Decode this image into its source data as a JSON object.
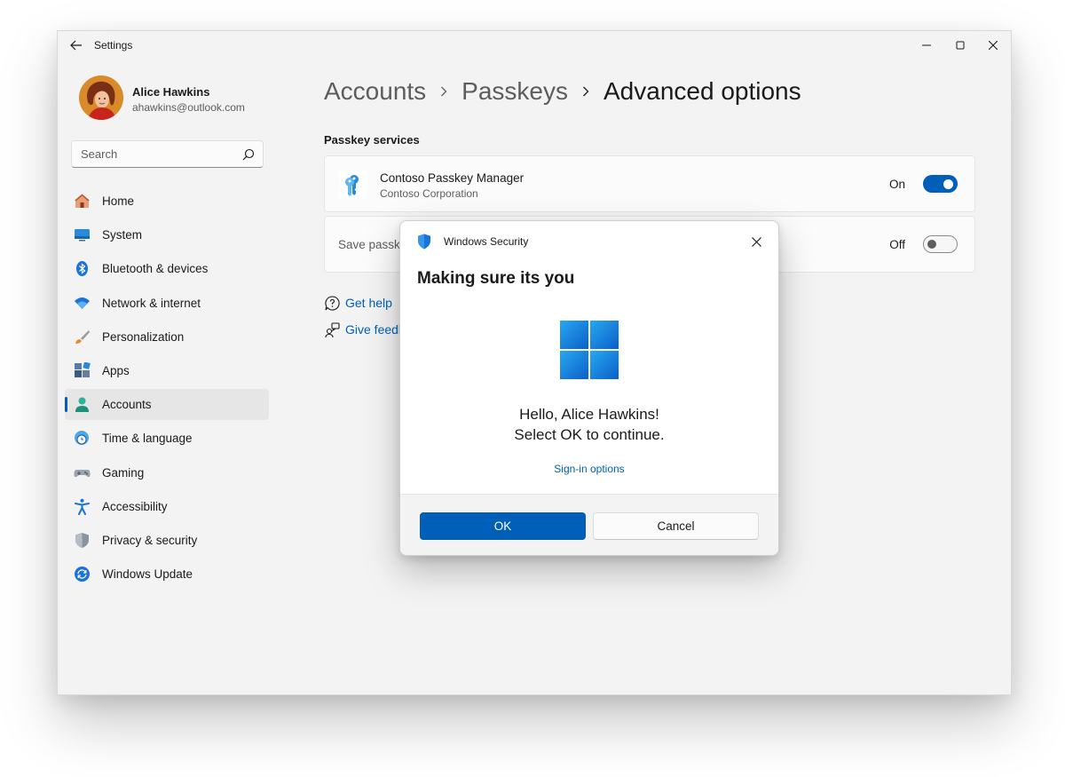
{
  "window": {
    "title": "Settings",
    "controls": [
      "minimize-icon",
      "maximize-icon",
      "close-icon"
    ]
  },
  "profile": {
    "name": "Alice Hawkins",
    "email": "ahawkins@outlook.com"
  },
  "search": {
    "placeholder": "Search"
  },
  "sidebar": {
    "items": [
      {
        "label": "Home",
        "icon": "home-icon"
      },
      {
        "label": "System",
        "icon": "system-icon"
      },
      {
        "label": "Bluetooth & devices",
        "icon": "bluetooth-icon"
      },
      {
        "label": "Network & internet",
        "icon": "wifi-icon"
      },
      {
        "label": "Personalization",
        "icon": "brush-icon"
      },
      {
        "label": "Apps",
        "icon": "apps-icon"
      },
      {
        "label": "Accounts",
        "icon": "accounts-icon",
        "active": true
      },
      {
        "label": "Time & language",
        "icon": "globe-clock-icon"
      },
      {
        "label": "Gaming",
        "icon": "gamepad-icon"
      },
      {
        "label": "Accessibility",
        "icon": "accessibility-icon"
      },
      {
        "label": "Privacy & security",
        "icon": "shield-icon"
      },
      {
        "label": "Windows Update",
        "icon": "update-icon"
      }
    ]
  },
  "breadcrumb": [
    "Accounts",
    "Passkeys",
    "Advanced options"
  ],
  "main": {
    "section_title": "Passkey services",
    "cards": [
      {
        "title": "Contoso Passkey Manager",
        "subtitle": "Contoso Corporation",
        "toggle_label": "On",
        "toggle_on": true
      },
      {
        "title": "Save passke",
        "toggle_label": "Off",
        "toggle_on": false
      }
    ],
    "links": [
      {
        "label": "Get help",
        "icon": "help-icon"
      },
      {
        "label": "Give feedl",
        "icon": "feedback-icon"
      }
    ]
  },
  "dialog": {
    "app_name": "Windows Security",
    "title": "Making sure its you",
    "greeting": "Hello, Alice Hawkins!",
    "instruction": "Select OK to continue.",
    "link": "Sign-in options",
    "ok_label": "OK",
    "cancel_label": "Cancel"
  },
  "colors": {
    "accent": "#005fb8",
    "window_bg": "#f3f3f3",
    "card_bg": "#fbfbfb"
  }
}
